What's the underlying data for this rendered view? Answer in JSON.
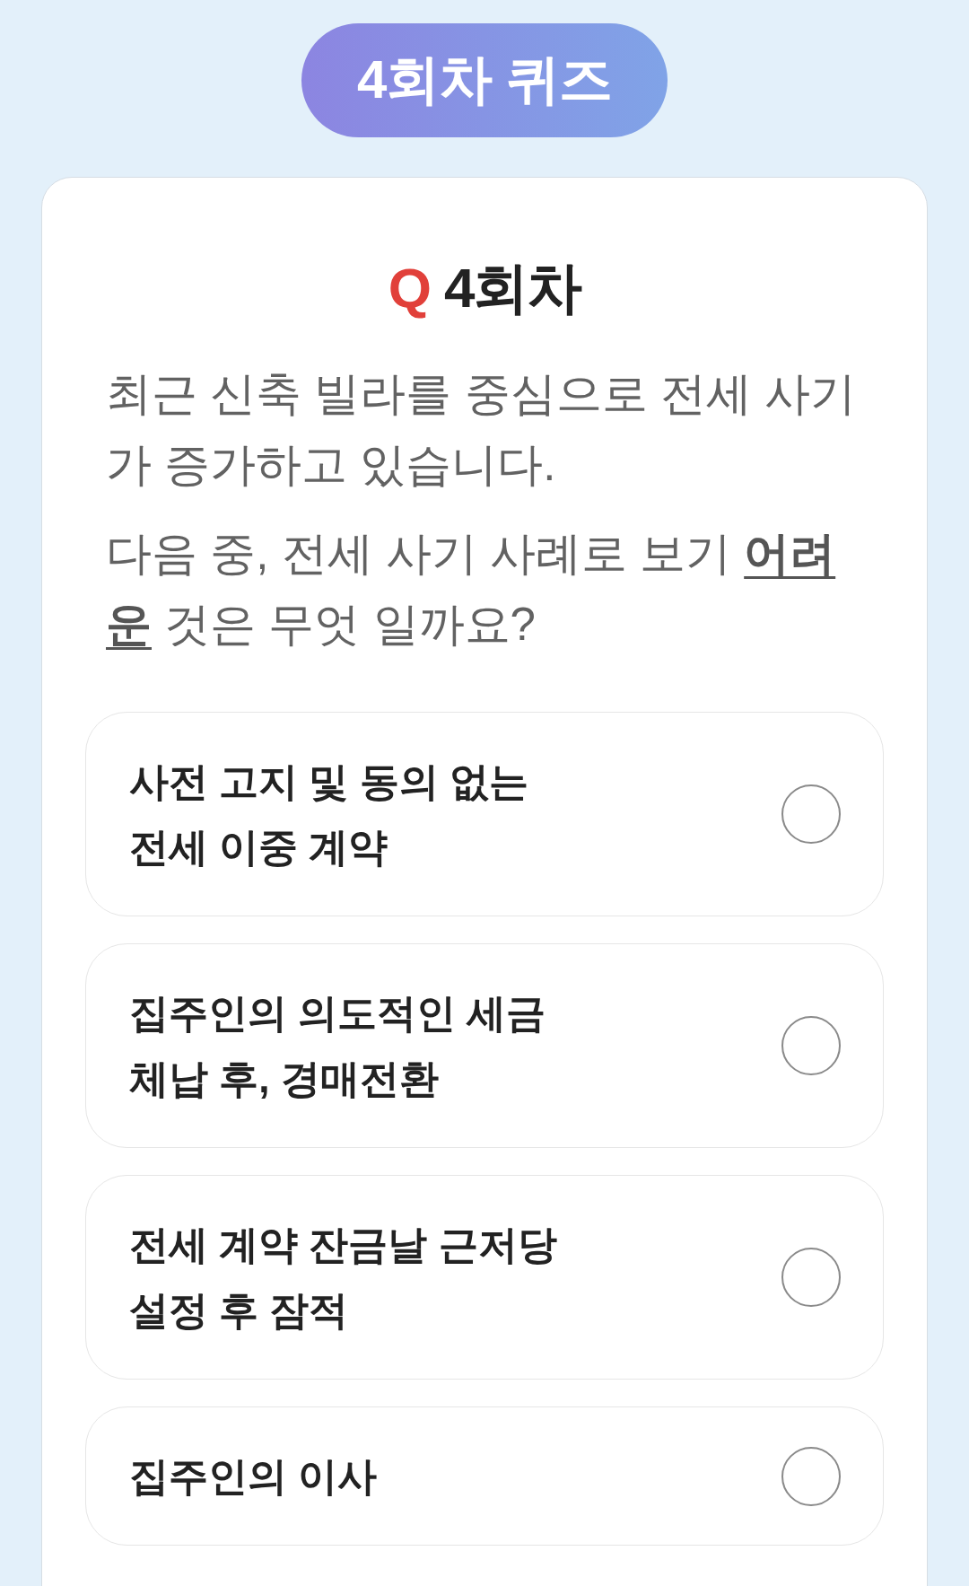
{
  "badge": {
    "label": "4회차 퀴즈"
  },
  "question": {
    "mark": "Q",
    "title": "4회차",
    "paragraphs": [
      "최근 신축 빌라를 중심으로 전세 사기가 증가하고 있습니다.",
      "다음 중, 전세 사기 사례로 보기 **어려운** 것은 무엇 일까요?"
    ]
  },
  "options": [
    {
      "label": "사전 고지 및 동의 없는 전세 이중 계약",
      "selected": false
    },
    {
      "label": "집주인의 의도적인 세금 체납 후, 경매전환",
      "selected": false
    },
    {
      "label": "전세 계약 잔금날 근저당 설정 후 잠적",
      "selected": false
    },
    {
      "label": "집주인의 이사",
      "selected": false
    }
  ]
}
